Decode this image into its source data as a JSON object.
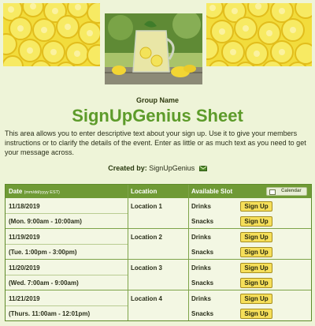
{
  "header": {
    "group_name": "Group Name",
    "title": "SignUpGenius Sheet",
    "description": "This area allows you to enter descriptive text about your sign up. Use it to give your members instructions or to clarify the details of the event. Enter as little or as much text as you need to get your message across.",
    "created_by_label": "Created by:",
    "created_by_name": "SignUpGenius"
  },
  "icons": {
    "mail": "envelope-icon",
    "calendar": "calendar-icon"
  },
  "colors": {
    "title_green": "#5d9b2a",
    "header_bar": "#6f9a35",
    "button_yellow": "#f6df5a",
    "background": "#eef4d8"
  },
  "table": {
    "headers": {
      "date": "Date",
      "date_format": "(mm/dd/yyyy EST)",
      "location": "Location",
      "slot": "Available Slot",
      "calendar_button": "Calendar"
    },
    "rows": [
      {
        "date": "11/18/2019",
        "time": "(Mon. 9:00am - 10:00am)",
        "location": "Location 1",
        "slots": [
          {
            "item": "Drinks",
            "button": "Sign Up"
          },
          {
            "item": "Snacks",
            "button": "Sign Up"
          }
        ]
      },
      {
        "date": "11/19/2019",
        "time": "(Tue. 1:00pm - 3:00pm)",
        "location": "Location 2",
        "slots": [
          {
            "item": "Drinks",
            "button": "Sign Up"
          },
          {
            "item": "Snacks",
            "button": "Sign Up"
          }
        ]
      },
      {
        "date": "11/20/2019",
        "time": "(Wed. 7:00am - 9:00am)",
        "location": "Location 3",
        "slots": [
          {
            "item": "Drinks",
            "button": "Sign Up"
          },
          {
            "item": "Snacks",
            "button": "Sign Up"
          }
        ]
      },
      {
        "date": "11/21/2019",
        "time": "(Thurs. 11:00am - 12:01pm)",
        "location": "Location 4",
        "slots": [
          {
            "item": "Drinks",
            "button": "Sign Up"
          },
          {
            "item": "Snacks",
            "button": "Sign Up"
          }
        ]
      }
    ]
  }
}
